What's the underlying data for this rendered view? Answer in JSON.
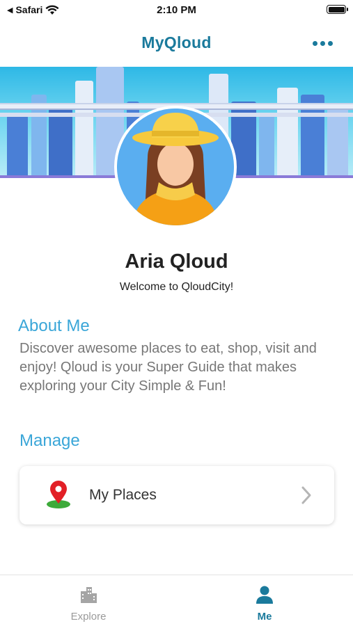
{
  "status_bar": {
    "back_app": "Safari",
    "time": "2:10 PM",
    "icons": [
      "back-arrow-icon",
      "wifi-icon",
      "battery-icon"
    ]
  },
  "nav": {
    "logo": "MyQloud",
    "menu_icon": "more-horizontal-icon"
  },
  "profile": {
    "name": "Aria Qloud",
    "welcome": "Welcome to QloudCity!"
  },
  "about": {
    "title": "About Me",
    "text": "Discover awesome places to eat, shop, visit and enjoy! Qloud is your Super Guide that makes exploring your City Simple & Fun!"
  },
  "manage": {
    "title": "Manage",
    "items": [
      {
        "label": "My Places",
        "icon": "map-pin-icon"
      }
    ]
  },
  "tabs": [
    {
      "label": "Explore",
      "icon": "building-icon",
      "active": false
    },
    {
      "label": "Me",
      "icon": "person-icon",
      "active": true
    }
  ],
  "colors": {
    "brand": "#1a7a9c",
    "section_title": "#3aa6d8",
    "body_text": "#777777",
    "inactive_tab": "#9a9a9a"
  }
}
